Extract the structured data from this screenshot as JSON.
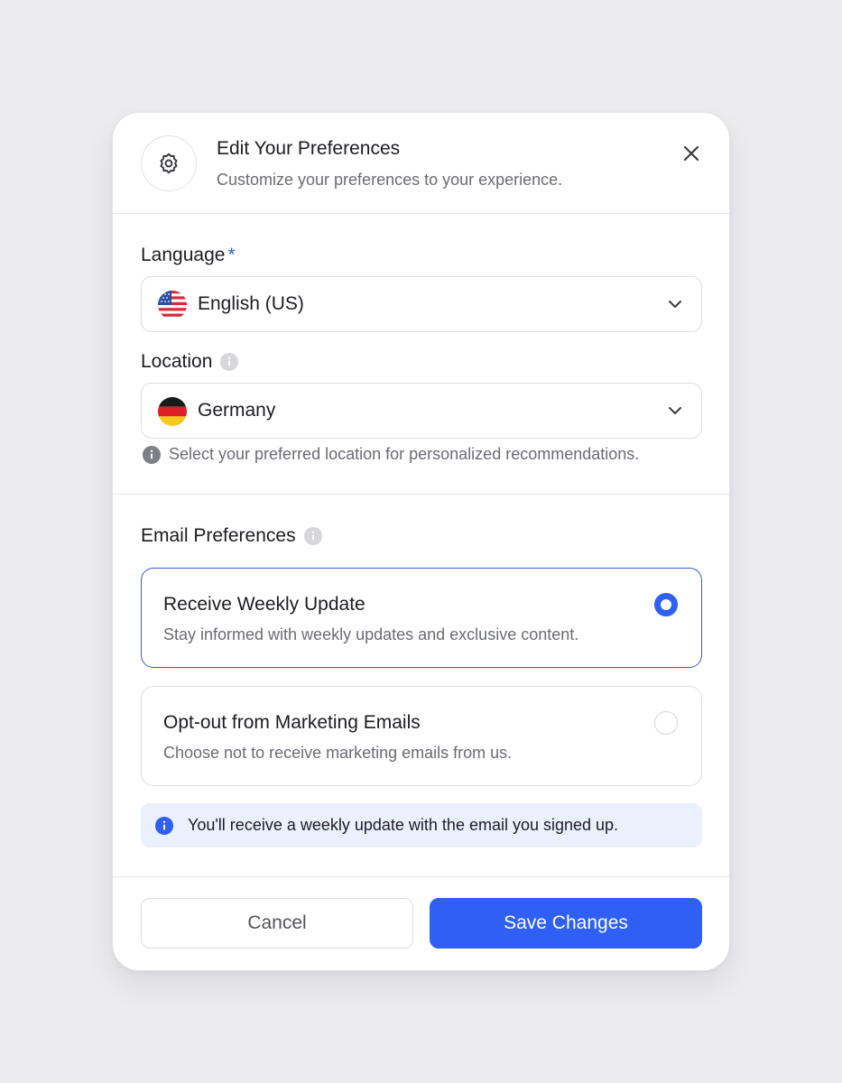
{
  "dialog": {
    "title": "Edit Your Preferences",
    "subtitle": "Customize your preferences to your experience.",
    "icon": "gear-icon",
    "close_icon": "close-icon"
  },
  "language": {
    "label": "Language",
    "required_marker": "*",
    "value": "English (US)",
    "flag": "us-flag-icon"
  },
  "location": {
    "label": "Location",
    "value": "Germany",
    "flag": "germany-flag-icon",
    "hint": "Select your preferred location for personalized recommendations."
  },
  "email_preferences": {
    "label": "Email Preferences",
    "options": [
      {
        "title": "Receive Weekly Update",
        "description": "Stay informed with weekly updates and exclusive content.",
        "selected": true
      },
      {
        "title": "Opt-out from Marketing Emails",
        "description": "Choose not to receive marketing emails from us.",
        "selected": false
      }
    ],
    "notice": "You'll receive a weekly update with the email you signed up."
  },
  "actions": {
    "cancel_label": "Cancel",
    "save_label": "Save Changes"
  },
  "colors": {
    "accent": "#2f5ff5",
    "selected_border": "#3a5cd8",
    "notice_bg": "#ebf0fd",
    "page_bg": "#ececef"
  }
}
